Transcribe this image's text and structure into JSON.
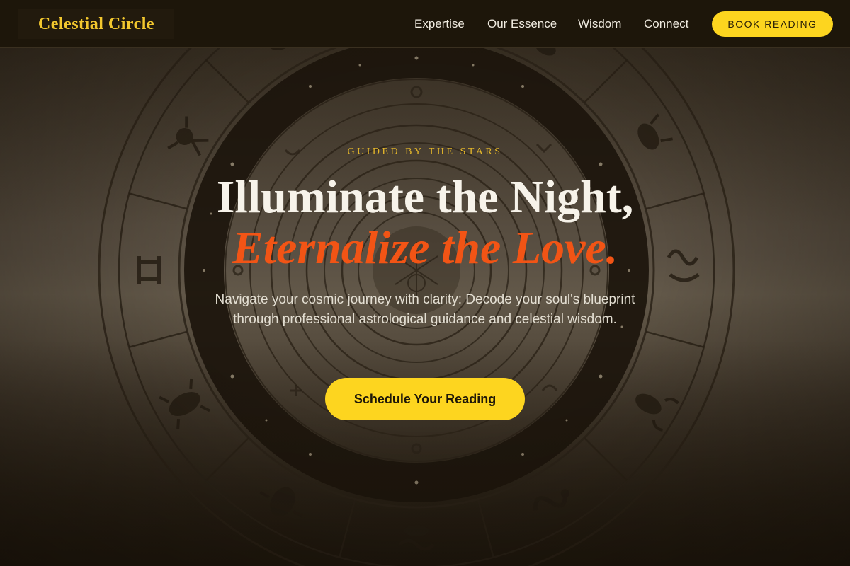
{
  "header": {
    "logo": "Celestial Circle",
    "nav": [
      "Expertise",
      "Our Essence",
      "Wisdom",
      "Connect"
    ],
    "book_label": "BOOK READING"
  },
  "hero": {
    "eyebrow": "GUIDED BY THE STARS",
    "headline_line1": "Illuminate the Night,",
    "headline_line2": "Eternalize the Love.",
    "subtitle": "Navigate your cosmic journey with clarity: Decode your soul's blueprint through professional astrological guidance and celestial wisdom.",
    "cta_label": "Schedule Your Reading",
    "background_image": "zodiac-wheel-illustration"
  },
  "colors": {
    "accent": "#fdd51f",
    "logo": "#f3c82e",
    "highlight": "#f25415",
    "header_bg": "#1d160a",
    "text_light": "#f7f3ea"
  }
}
